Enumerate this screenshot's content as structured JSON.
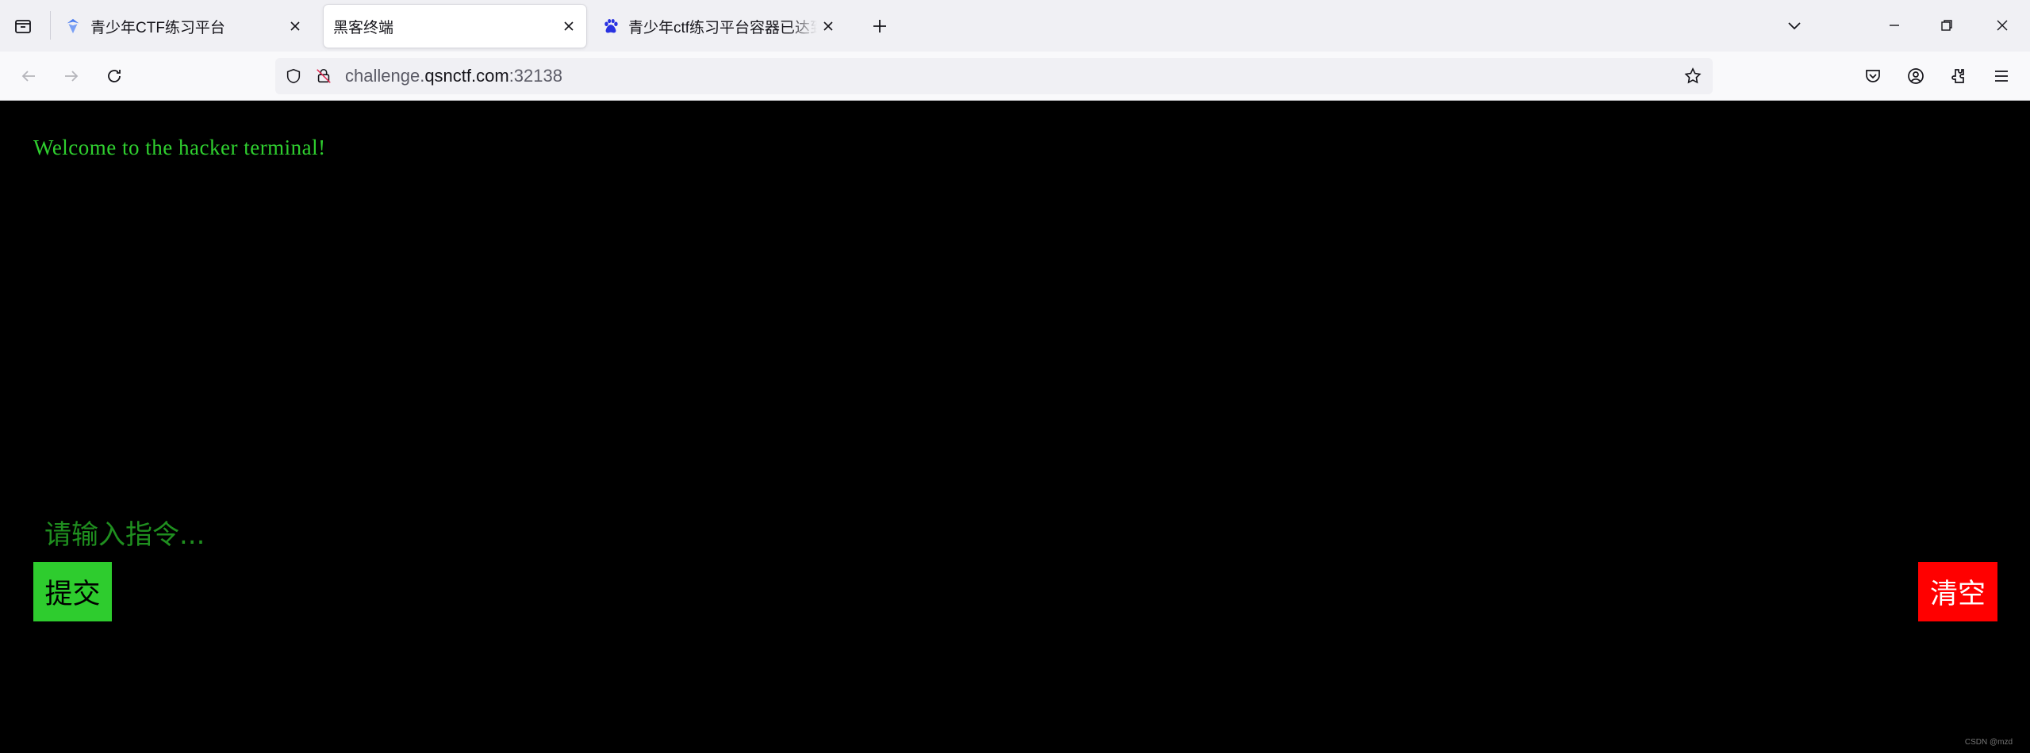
{
  "browser": {
    "tabs": [
      {
        "title": "青少年CTF练习平台",
        "active": false,
        "favicon": "qsnctf-logo-icon"
      },
      {
        "title": "黑客终端",
        "active": true,
        "favicon": ""
      },
      {
        "title": "青少年ctf练习平台容器已达到最",
        "active": false,
        "favicon": "baidu-paw-icon"
      }
    ],
    "url": {
      "subdomain": "challenge.",
      "host": "qsnctf.com",
      "port": ":32138"
    }
  },
  "page": {
    "welcome": "Welcome to the hacker terminal!",
    "input_placeholder": "请输入指令...",
    "submit_label": "提交",
    "clear_label": "清空",
    "watermark": "CSDN @mzd"
  },
  "colors": {
    "terminal_green": "#2fcf2f",
    "submit_bg": "#2ecc2e",
    "clear_bg": "#ff0000",
    "page_bg": "#000000"
  }
}
